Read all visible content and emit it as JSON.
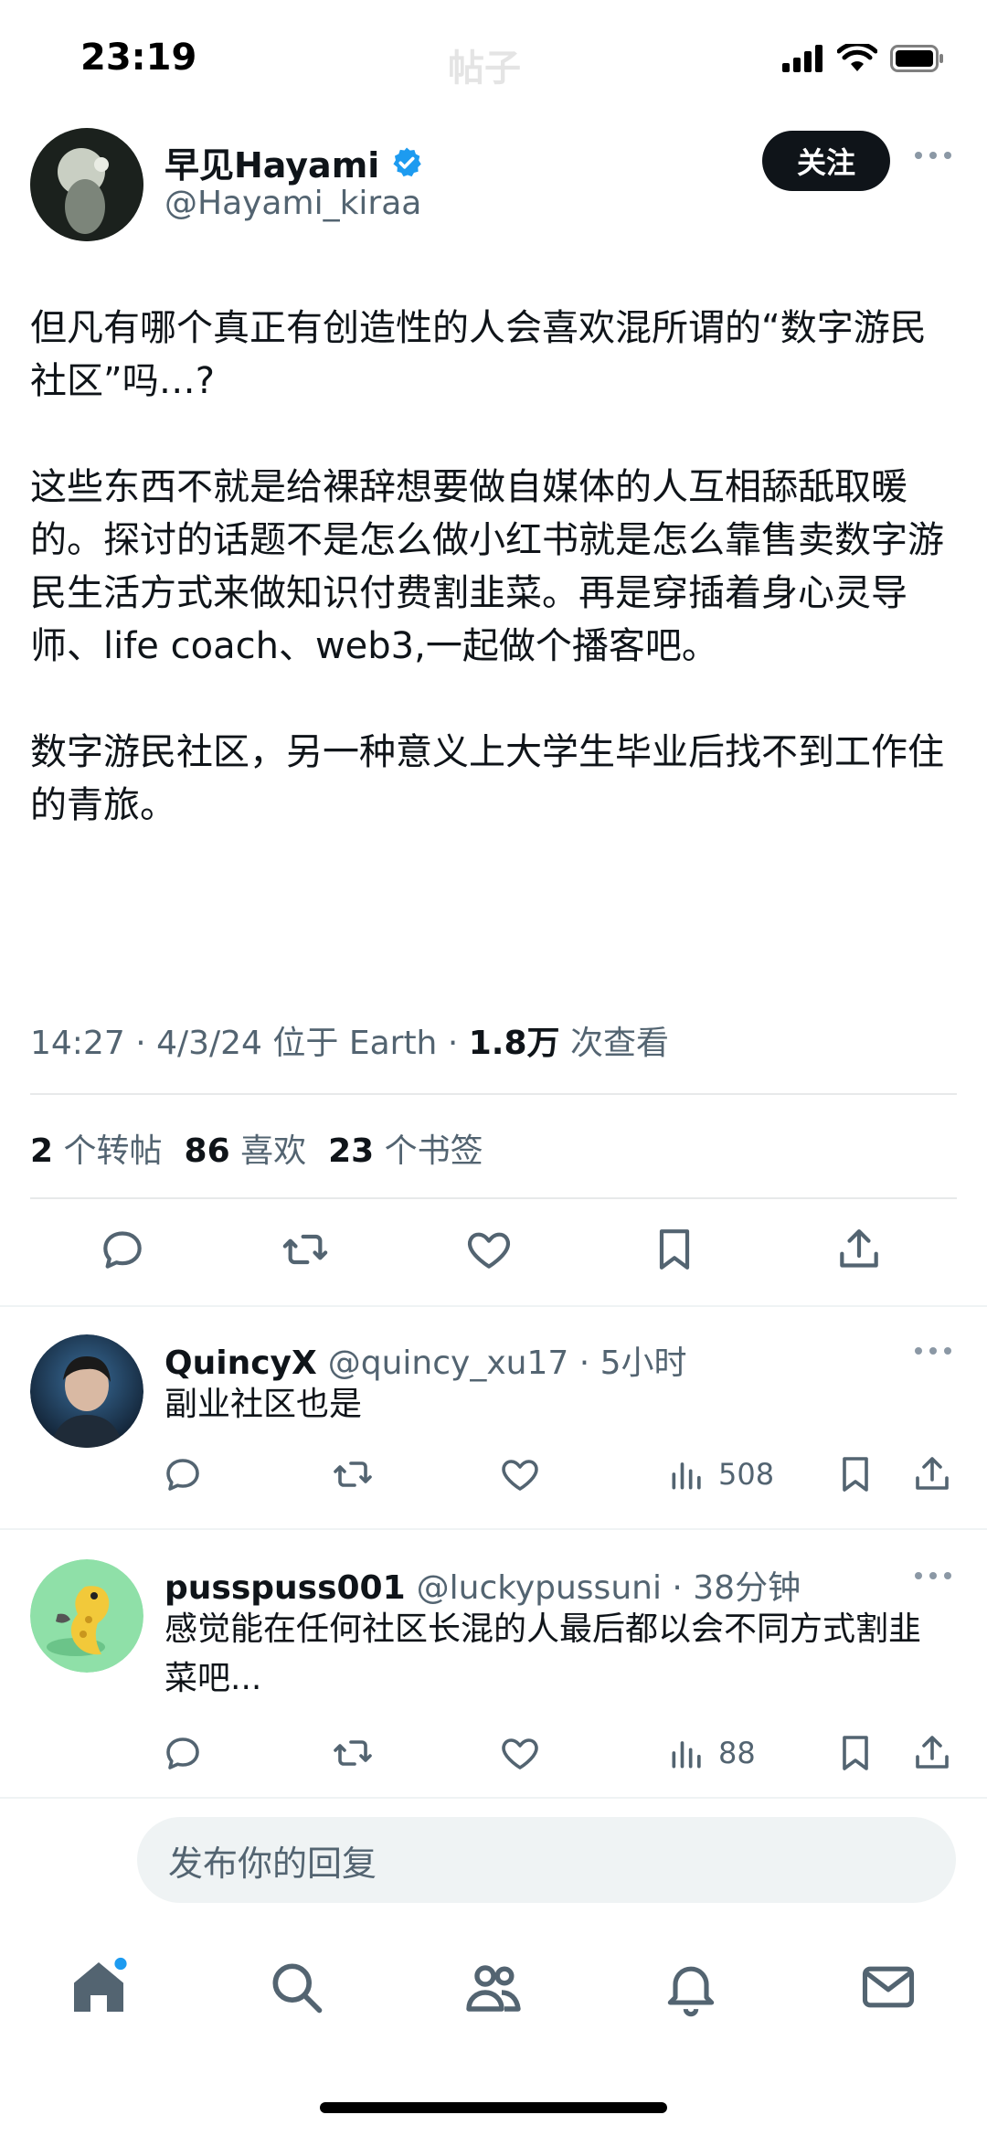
{
  "status_bar": {
    "time": "23:19"
  },
  "nav": {
    "title": "帖子"
  },
  "tweet": {
    "author_name": "早见Hayami",
    "author_handle": "@Hayami_kiraa",
    "follow_label": "关注",
    "paragraphs": [
      "但凡有哪个真正有创造性的人会喜欢混所谓的“数字游民社区”吗…?",
      "这些东西不就是给裸辞想要做自媒体的人互相舔舐取暖的。探讨的话题不是怎么做小红书就是怎么靠售卖数字游民生活方式来做知识付费割韭菜。再是穿插着身心灵导师、life coach、web3,一起做个播客吧。",
      "数字游民社区，另一种意义上大学生毕业后找不到工作住的青旅。"
    ],
    "meta_prefix": "14:27 · 4/3/24 位于 Earth · ",
    "views_count": "1.8万",
    "views_label": " 次查看",
    "reposts_count": "2",
    "reposts_label": "个转帖",
    "likes_count": "86",
    "likes_label": "喜欢",
    "bookmarks_count": "23",
    "bookmarks_label": "个书签"
  },
  "replies": [
    {
      "name": "QuincyX",
      "handle_time": "@quincy_xu17 · 5小时",
      "text": "副业社区也是",
      "views": "508"
    },
    {
      "name": "pusspuss001",
      "handle_time": "@luckypussuni · 38分钟",
      "text": "感觉能在任何社区长混的人最后都以会不同方式割韭菜吧...",
      "views": "88"
    }
  ],
  "reply_input": {
    "placeholder": "发布你的回复"
  },
  "colors": {
    "accent": "#1d9bf0",
    "text": "#0f1419",
    "secondary": "#536471"
  },
  "icons": [
    "reply-icon",
    "retweet-icon",
    "like-icon",
    "bookmark-icon",
    "share-icon",
    "views-icon",
    "home-icon",
    "search-icon",
    "communities-icon",
    "notifications-icon",
    "messages-icon"
  ]
}
